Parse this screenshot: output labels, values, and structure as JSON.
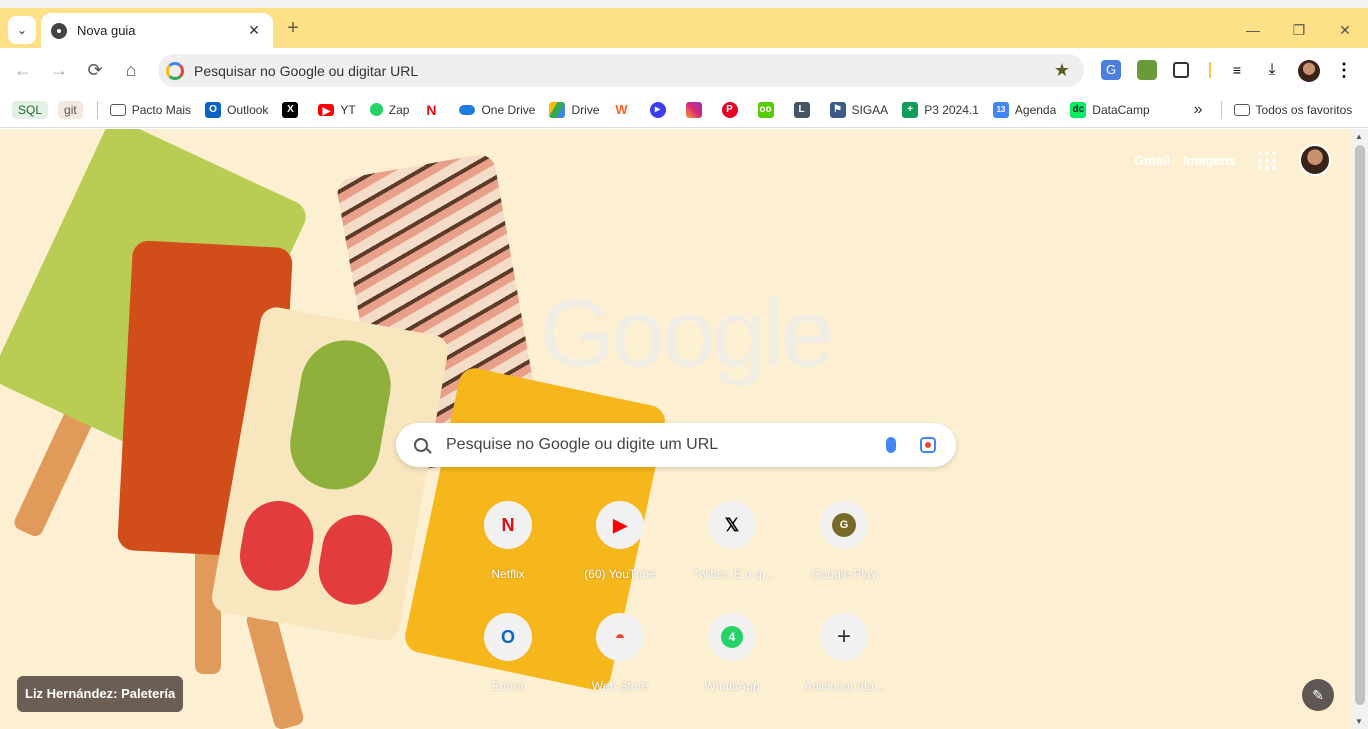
{
  "tab": {
    "title": "Nova guia",
    "close": "✕",
    "new_tab": "+"
  },
  "window_controls": {
    "minimize": "—",
    "restore": "❐",
    "close": "✕"
  },
  "toolbar": {
    "back": "←",
    "forward": "→",
    "reload": "⟳",
    "home": "⌂",
    "omnibox_text": "Pesquisar no Google ou digitar URL",
    "star": "★",
    "more": "⋮"
  },
  "bookmarks": {
    "pills": [
      "SQL",
      "git"
    ],
    "items": [
      {
        "label": "Pacto Mais",
        "icon": "folder-icon"
      },
      {
        "label": "Outlook",
        "icon": "outlook-icon"
      },
      {
        "label": "",
        "icon": "x-icon"
      },
      {
        "label": "YT",
        "icon": "youtube-icon"
      },
      {
        "label": "Zap",
        "icon": "whatsapp-icon"
      },
      {
        "label": "",
        "icon": "netflix-icon"
      },
      {
        "label": "One Drive",
        "icon": "onedrive-icon"
      },
      {
        "label": "Drive",
        "icon": "drive-icon"
      },
      {
        "label": "",
        "icon": "wattpad-icon"
      },
      {
        "label": "",
        "icon": "video-icon"
      },
      {
        "label": "",
        "icon": "instagram-icon"
      },
      {
        "label": "",
        "icon": "pinterest-icon"
      },
      {
        "label": "",
        "icon": "duolingo-icon"
      },
      {
        "label": "",
        "icon": "letterboxd-icon"
      },
      {
        "label": "SIGAA",
        "icon": "sigaa-icon"
      },
      {
        "label": "P3 2024.1",
        "icon": "sheets-icon"
      },
      {
        "label": "Agenda",
        "icon": "calendar-icon"
      },
      {
        "label": "DataCamp",
        "icon": "datacamp-icon"
      }
    ],
    "overflow": "»",
    "all_bookmarks": "Todos os favoritos"
  },
  "ntp": {
    "gmail": "Gmail",
    "images": "Imagens",
    "logo": "Google",
    "search_placeholder": "Pesquise no Google ou digite um URL",
    "shortcuts": [
      {
        "label": "Netflix",
        "glyph": "N",
        "color": "#e50914"
      },
      {
        "label": "(60) YouTube",
        "glyph": "▶",
        "color": "#ff0000"
      },
      {
        "label": "Twitter. É o q...",
        "glyph": "𝕏",
        "color": "#000000"
      },
      {
        "label": "Google Play",
        "glyph": "G",
        "color": "#7a6a2a"
      },
      {
        "label": "Entrar",
        "glyph": "O",
        "color": "#0a64c8"
      },
      {
        "label": "Web Store",
        "glyph": "◓",
        "color": "#ea4335"
      },
      {
        "label": "WhatsApp",
        "glyph": "4",
        "color": "#25d366"
      },
      {
        "label": "Adicionar ata...",
        "glyph": "+",
        "color": "#333333"
      }
    ],
    "attribution": "Liz Hernández: Paletería",
    "edit": "✎"
  },
  "colors": {
    "titlebar": "#fee086",
    "ntp_bg": "#fdf0d2"
  }
}
